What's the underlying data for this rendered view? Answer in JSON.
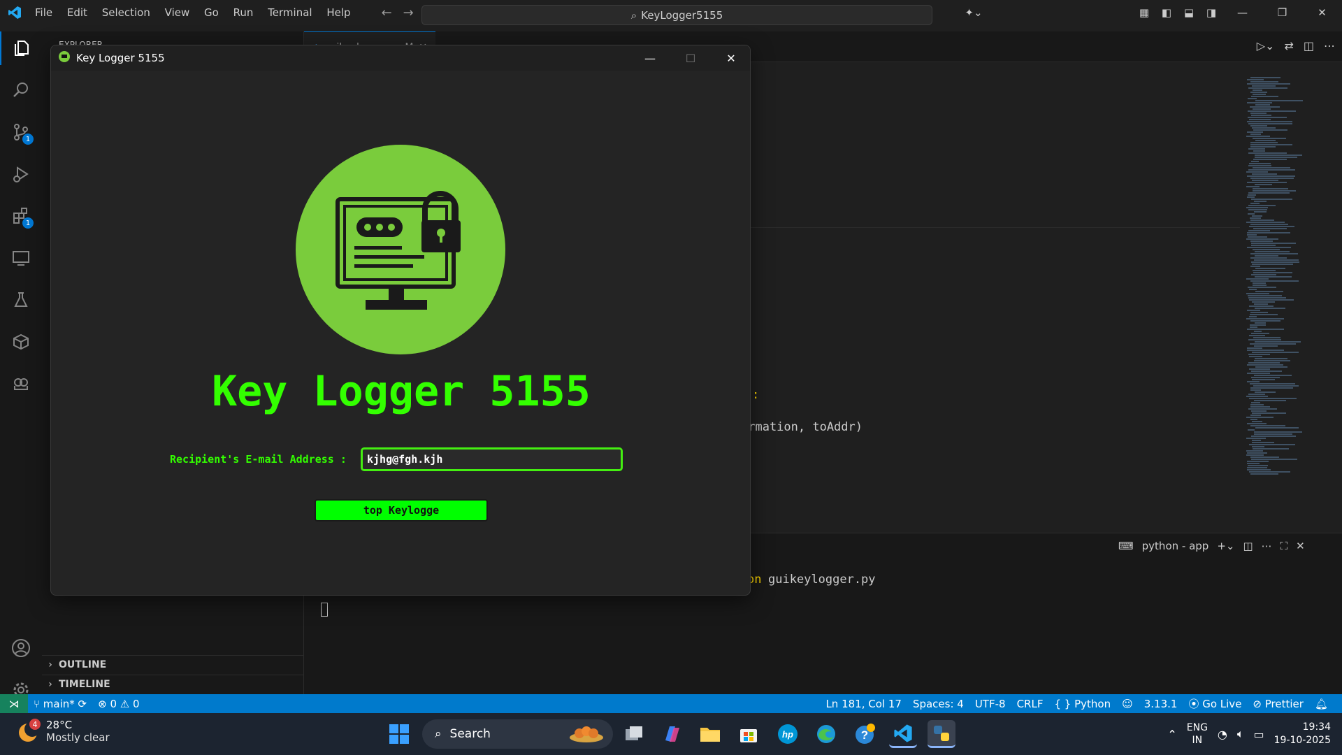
{
  "vscode": {
    "menu": [
      "File",
      "Edit",
      "Selection",
      "View",
      "Go",
      "Run",
      "Terminal",
      "Help"
    ],
    "search": "KeyLogger5155",
    "tab_label": "guikeylogger.py M",
    "sidebar_header": "EXPLORER",
    "sidebar_sections": [
      "OUTLINE",
      "TIMELINE"
    ],
    "activity_badges": {
      "source_control": "1",
      "extensions": "1"
    },
    "code_visible": [
      ":",
      "ormation, toAddr)"
    ],
    "terminal": {
      "tab_label": "python - app",
      "command_fragment": "on",
      "command_file": "guikeylogger.py"
    },
    "colors": {
      "accent": "#0078d4",
      "status_bar": "#007acc"
    }
  },
  "statusbar": {
    "branch": "main*",
    "errors": "0",
    "warnings": "0",
    "position": "Ln 181, Col 17",
    "spaces": "Spaces: 4",
    "encoding": "UTF-8",
    "eol": "CRLF",
    "language": "Python",
    "python_version": "3.13.1",
    "go_live": "Go Live",
    "prettier": "Prettier"
  },
  "app": {
    "window_title": "Key Logger 5155",
    "heading": "Key Logger 5155",
    "email_label": "Recipient's E-mail Address :",
    "email_value": "kjhg@fgh.kjh",
    "button_label": "top Keylogge",
    "colors": {
      "text": "#33ff00",
      "button": "#00ff00",
      "logo_circle": "#7acc3c"
    }
  },
  "taskbar": {
    "weather_badge": "4",
    "temperature": "28°C",
    "condition": "Mostly clear",
    "search_label": "Search",
    "language": "ENG",
    "region": "IN",
    "time": "19:34",
    "date": "19-10-2025"
  }
}
